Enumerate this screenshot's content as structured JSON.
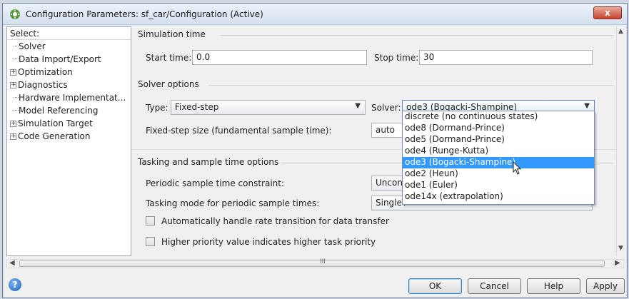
{
  "window": {
    "title": "Configuration Parameters: sf_car/Configuration (Active)",
    "close_label": "x"
  },
  "tree": {
    "header": "Select:",
    "items": [
      {
        "label": "Solver",
        "expandable": false,
        "selected": true
      },
      {
        "label": "Data Import/Export",
        "expandable": false
      },
      {
        "label": "Optimization",
        "expandable": true
      },
      {
        "label": "Diagnostics",
        "expandable": true
      },
      {
        "label": "Hardware Implementat...",
        "expandable": false
      },
      {
        "label": "Model Referencing",
        "expandable": false
      },
      {
        "label": "Simulation Target",
        "expandable": true
      },
      {
        "label": "Code Generation",
        "expandable": true
      }
    ]
  },
  "simulation_time": {
    "section_title": "Simulation time",
    "start_label": "Start time:",
    "start_value": "0.0",
    "stop_label": "Stop time:",
    "stop_value": "30"
  },
  "solver_options": {
    "section_title": "Solver options",
    "type_label": "Type:",
    "type_value": "Fixed-step",
    "solver_label": "Solver:",
    "solver_value": "ode3 (Bogacki-Shampine)",
    "step_size_label": "Fixed-step size (fundamental sample time):",
    "step_size_value": "auto"
  },
  "solver_dropdown": {
    "options": [
      "discrete (no continuous states)",
      "ode8 (Dormand-Prince)",
      "ode5 (Dormand-Prince)",
      "ode4 (Runge-Kutta)",
      "ode3 (Bogacki-Shampine)",
      "ode2 (Heun)",
      "ode1 (Euler)",
      "ode14x (extrapolation)"
    ],
    "selected": "ode3 (Bogacki-Shampine)"
  },
  "tasking": {
    "section_title": "Tasking and sample time options",
    "periodic_label": "Periodic sample time constraint:",
    "periodic_value": "Uncons",
    "mode_label": "Tasking mode for periodic sample times:",
    "mode_value": "SingleT",
    "auto_rate_label": "Automatically handle rate transition for data transfer",
    "auto_rate_checked": false,
    "priority_label": "Higher priority value indicates higher task priority",
    "priority_checked": false
  },
  "footer": {
    "help_icon_label": "?",
    "ok_label": "OK",
    "cancel_label": "Cancel",
    "help_label": "Help",
    "apply_label": "Apply"
  },
  "scrollbar": {
    "grip_label": "III"
  },
  "colors": {
    "selection": "#3399ff",
    "title_gradient_top": "#eef3fa",
    "close_button": "#c7432f"
  }
}
